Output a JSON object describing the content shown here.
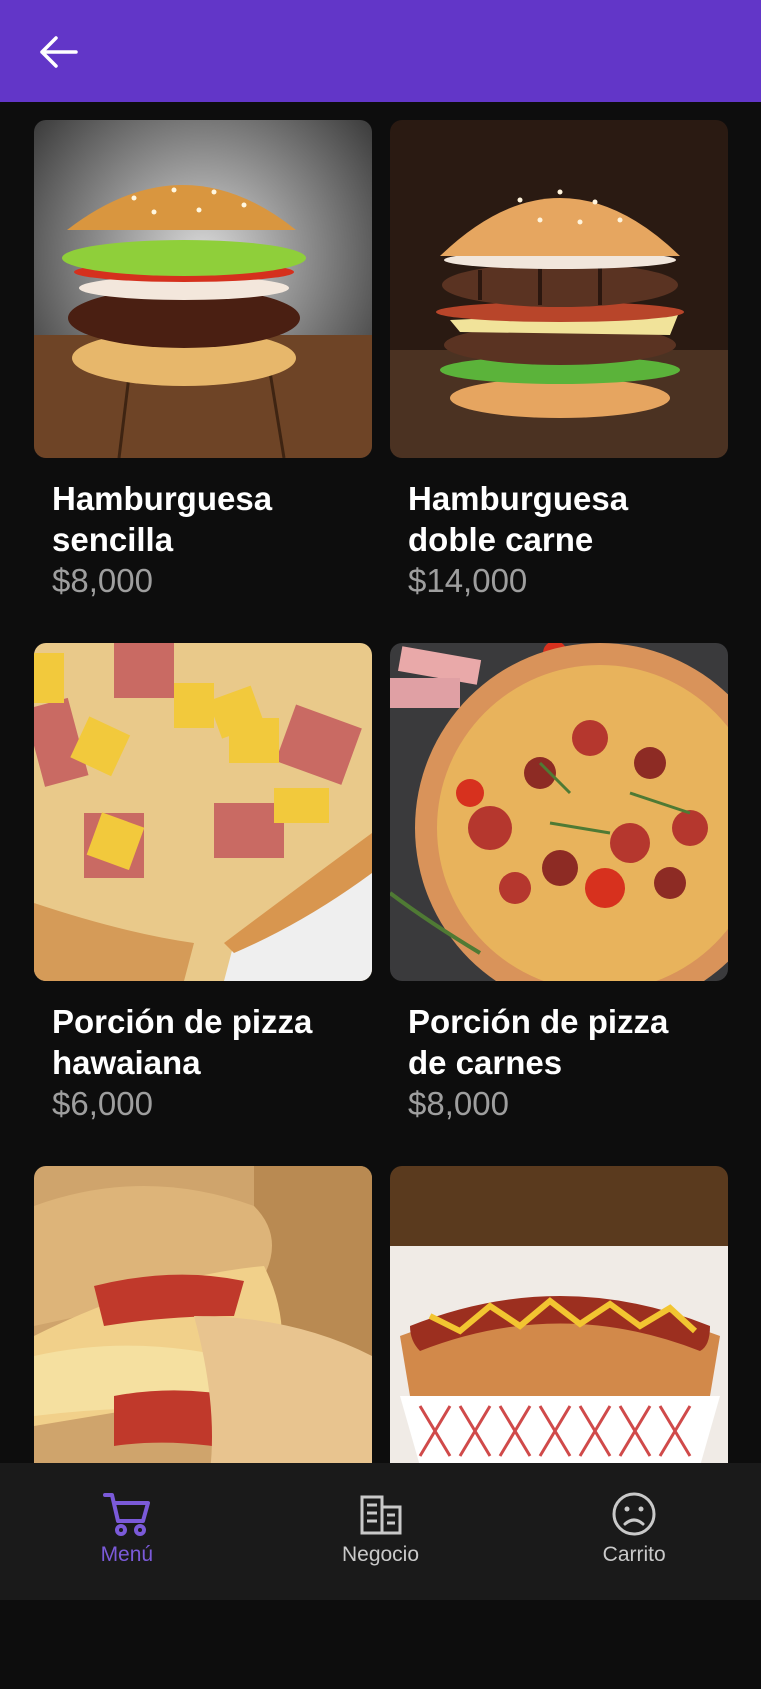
{
  "header": {
    "back_icon": "arrow-left-icon",
    "background": "#6236c8"
  },
  "products": [
    {
      "name": "Hamburguesa sencilla",
      "price": "$8,000",
      "image": "hamburger-photo"
    },
    {
      "name": "Hamburguesa doble carne",
      "price": "$14,000",
      "image": "double-burger-photo"
    },
    {
      "name": "Porción de pizza hawaiana",
      "price": "$6,000",
      "image": "hawaiian-pizza-photo"
    },
    {
      "name": "Porción de pizza de carnes",
      "price": "$8,000",
      "image": "meat-pizza-photo"
    },
    {
      "name": "",
      "price": "",
      "image": "calzone-photo"
    },
    {
      "name": "",
      "price": "",
      "image": "hot-dog-photo"
    }
  ],
  "bottom_nav": {
    "items": [
      {
        "label": "Menú",
        "icon": "cart-icon",
        "active": true
      },
      {
        "label": "Negocio",
        "icon": "building-icon",
        "active": false
      },
      {
        "label": "Carrito",
        "icon": "sad-face-icon",
        "active": false
      }
    ],
    "active_color": "#7b5ad9",
    "inactive_color": "#c9c9c9"
  }
}
